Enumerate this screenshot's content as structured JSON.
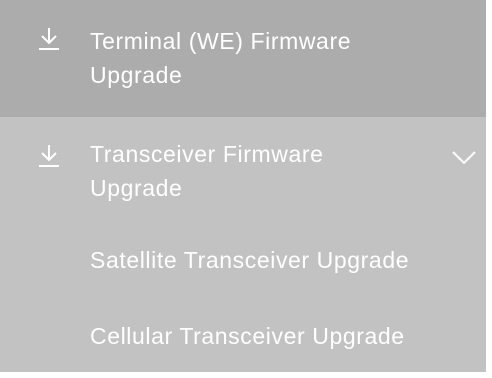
{
  "menu": {
    "items": [
      {
        "line1": "Terminal (WE) Firmware",
        "line2": "Upgrade",
        "icon": "download-icon"
      },
      {
        "line1": "Transceiver Firmware",
        "line2": "Upgrade",
        "icon": "download-icon",
        "toggle_icon": "chevron-down-icon",
        "expanded": true,
        "children": [
          {
            "label": "Satellite Transceiver Upgrade"
          },
          {
            "label": "Cellular Transceiver Upgrade"
          }
        ]
      }
    ]
  },
  "colors": {
    "menu_background": "#c2c2c2",
    "active_item_background": "#acacac",
    "text": "#ffffff"
  }
}
